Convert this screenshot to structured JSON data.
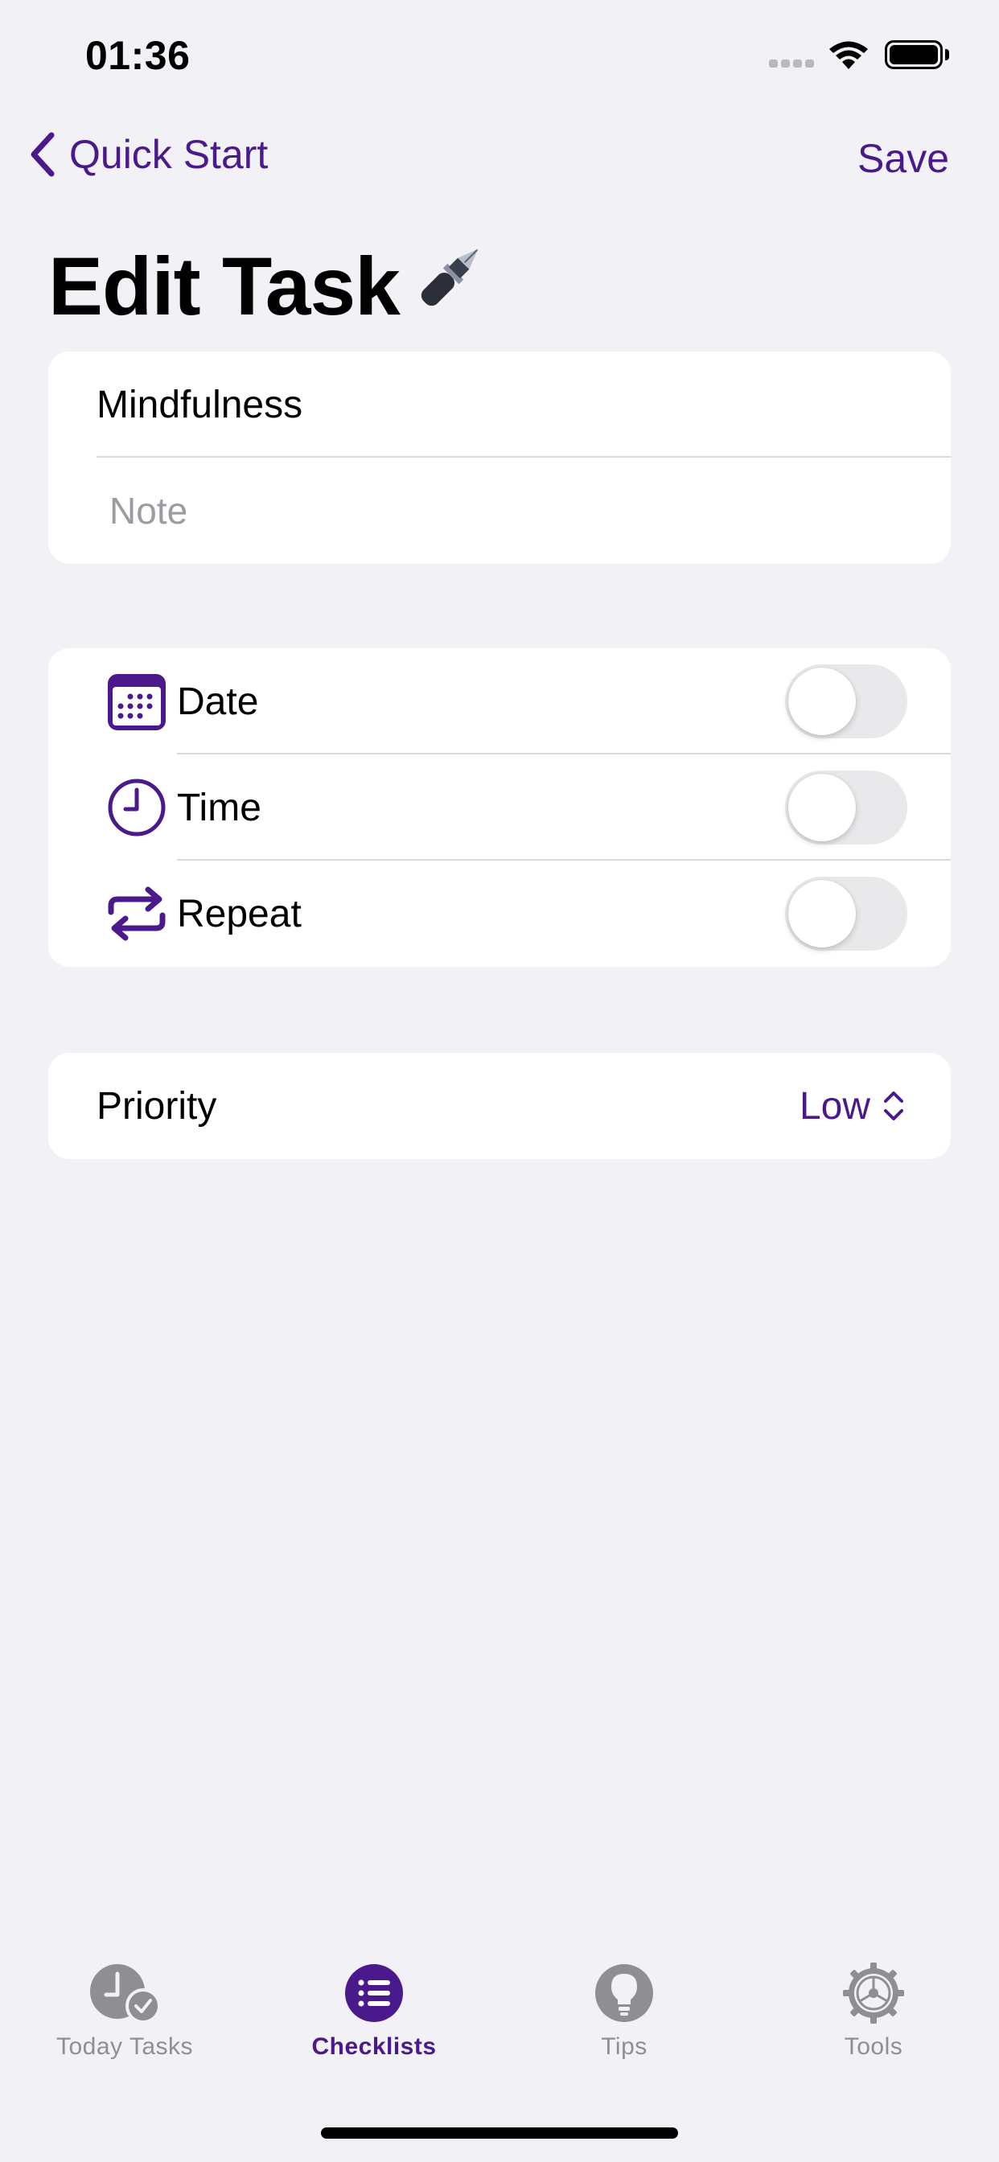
{
  "status_bar": {
    "time": "01:36"
  },
  "nav": {
    "back_label": "Quick Start",
    "save_label": "Save"
  },
  "page": {
    "title": "Edit Task",
    "title_emoji": "🖋️"
  },
  "task": {
    "name": "Mindfulness",
    "note_placeholder": "Note"
  },
  "options": [
    {
      "label": "Date",
      "icon": "calendar-icon",
      "enabled": false
    },
    {
      "label": "Time",
      "icon": "clock-icon",
      "enabled": false
    },
    {
      "label": "Repeat",
      "icon": "repeat-icon",
      "enabled": false
    }
  ],
  "priority": {
    "label": "Priority",
    "value": "Low"
  },
  "tabs": [
    {
      "label": "Today Tasks",
      "icon": "clock-check-icon",
      "active": false
    },
    {
      "label": "Checklists",
      "icon": "list-icon",
      "active": true
    },
    {
      "label": "Tips",
      "icon": "lightbulb-icon",
      "active": false
    },
    {
      "label": "Tools",
      "icon": "gear-icon",
      "active": false
    }
  ],
  "colors": {
    "accent": "#4a1a8c",
    "background": "#f2f1f6",
    "inactive": "#8e8e93"
  }
}
